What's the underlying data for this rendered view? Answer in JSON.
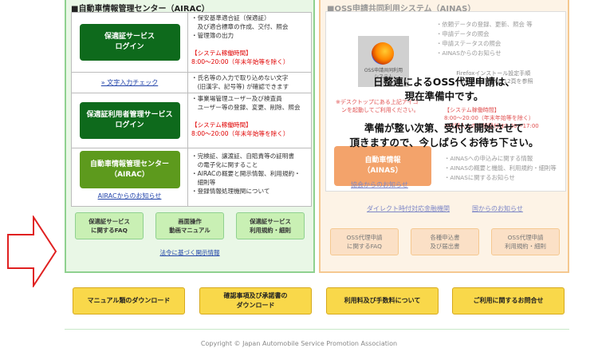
{
  "airac": {
    "title": "■自動車情報管理センター（AIRAC）",
    "rows": [
      {
        "button": "保適証サービス\nログイン",
        "lines": [
          "・保安基準適合証（保適証）",
          "　及び適合標章の作成、交付、照会",
          "・管理簿の出力",
          "",
          "【システム稼働時間】",
          "8:00～20:00（年末年始等を除く）"
        ]
      },
      {
        "link": "» 文字入力チェック",
        "lines": [
          "・氏名等の入力で取り込めない文字",
          "　(旧漢字、記号等) が確認できます"
        ]
      },
      {
        "button": "保適証利用者管理サービス\nログイン",
        "lines": [
          "・事業場管理ユーザー及び検査員",
          "　ユーザー等の登録、変更、削除、照会",
          "",
          "【システム稼働時間】",
          "8:00～20:00（年末年始等を除く）"
        ]
      },
      {
        "button": "自動車情報管理センター\n（AIRAC）",
        "link": "AIRACからのお知らせ",
        "lines": [
          "・完検証、譲渡証、自賠責等の証明書",
          "　の電子化に関すること",
          "・AIRACの概要と開示情報、利用規約・",
          "　細則等",
          "・登録情報処理機関について"
        ]
      }
    ],
    "sub_buttons": [
      "保適証サービス\nに関するFAQ",
      "画面操作\n動画マニュアル",
      "保適証サービス\n利用規約・細則"
    ],
    "legal_link": "法令に基づく開示情報"
  },
  "oss": {
    "title": "■OSS申請共同利用システム（AINAS）",
    "icon_caption": "OSS申請共同利用\nシステム",
    "list1": [
      "・依頼データの登録、更新、照会 等",
      "・申請データの照会",
      "・申請ステータスの照会",
      "・AINASからのお知らせ"
    ],
    "ff_note": "Firefoxインストール設定手順\n【依頼人様】PDFの12頁を参照",
    "red1": "※デスクトップにある上記アイコ\n　ンを起動してご利用ください。",
    "red2": "【システム稼働時間】\n8:00～20:00（年末年始等を除く）\n※代理人への申請受付は9:00～17:00",
    "ainas_button": "自動車情報\n（AINAS）",
    "list2": [
      "・AINASへの申込みに関する情報",
      "・AINASの概要と機能、利用規約・細則等",
      "・AINASに関するお知らせ"
    ],
    "links": [
      "協会からのお知らせ",
      "ダイレクト時付対応金融機関",
      "国からのお知らせ"
    ],
    "sub_buttons": [
      "OSS代理申請\nに関するFAQ",
      "各種申込書\n及び届出書",
      "OSS代理申請\n利用規約・細則"
    ]
  },
  "overlay": {
    "line1": "日整連によるOSS代理申請は、\n現在準備中です。",
    "line2": "準備が整い次第、受付を開始させて\n頂きますので、今しばらくお待ち下さい。"
  },
  "bottom_buttons": [
    "マニュアル類のダウンロード",
    "確認事項及び承諾書の\nダウンロード",
    "利用料及び手数料について",
    "ご利用に関するお問合せ"
  ],
  "copyright": "Copyright © Japan Automobile Service Promotion Association",
  "colors": {
    "airac_border": "#8fd18f",
    "oss_border": "#f5c890",
    "green_button": "#0e6a1c",
    "yellow_button": "#f9d84a",
    "red_text": "#e00000"
  }
}
